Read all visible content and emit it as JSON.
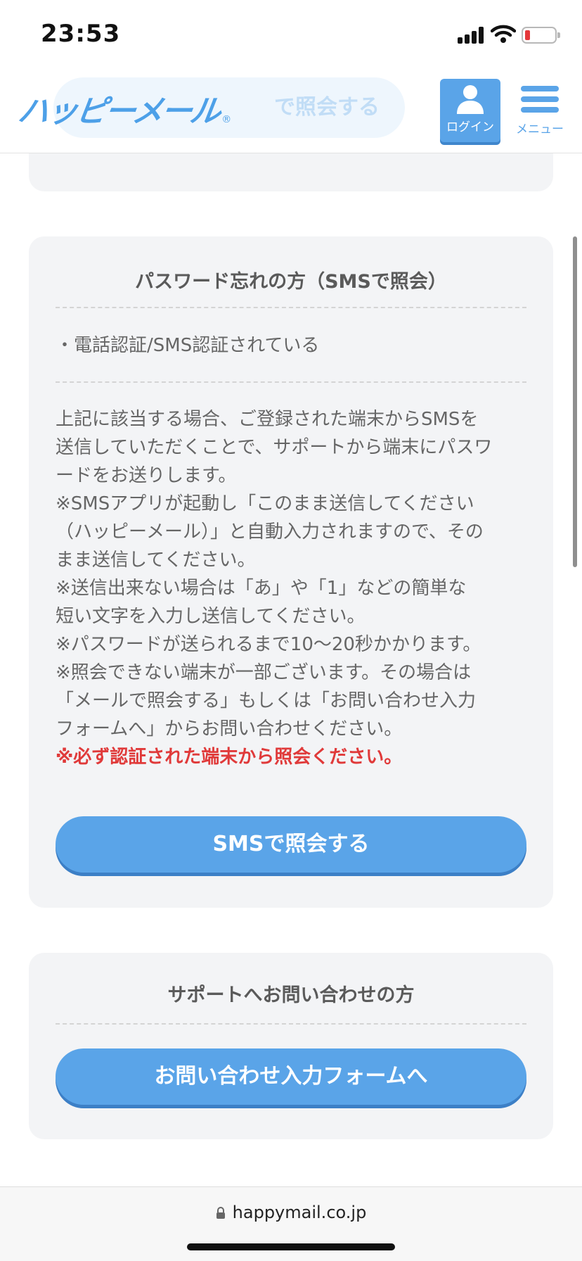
{
  "status_bar": {
    "time": "23:53"
  },
  "header": {
    "logo_text": "ハッピーメール",
    "logo_registered": "®",
    "login_label": "ログイン",
    "menu_label": "メニュー",
    "ghost_button_fragment": "で照会する"
  },
  "sms_section": {
    "title": "パスワード忘れの方（SMSで照会）",
    "condition": "・電話認証/SMS認証されている",
    "description_lines": [
      "上記に該当する場合、ご登録された端末からSMSを",
      "送信していただくことで、サポートから端末にパスワ",
      "ードをお送りします。",
      "※SMSアプリが起動し「このまま送信してください",
      "（ハッピーメール）」と自動入力されますので、その",
      "まま送信してください。",
      "※送信出来ない場合は「あ」や「1」などの簡単な",
      "短い文字を入力し送信してください。",
      "※パスワードが送られるまで10〜20秒かかります。",
      "※照会できない端末が一部ございます。その場合は",
      "「メールで照会する」もしくは「お問い合わせ入力",
      "フォームへ」からお問い合わせください。"
    ],
    "warning": "※必ず認証された端末から照会ください。",
    "button_label": "SMSで照会する"
  },
  "support_section": {
    "title": "サポートへお問い合わせの方",
    "button_label": "お問い合わせ入力フォームへ"
  },
  "url_bar": {
    "url": "happymail.co.jp"
  },
  "colors": {
    "accent": "#5aa4e8",
    "warning": "#e03a3a",
    "card_bg": "#f3f4f6"
  }
}
